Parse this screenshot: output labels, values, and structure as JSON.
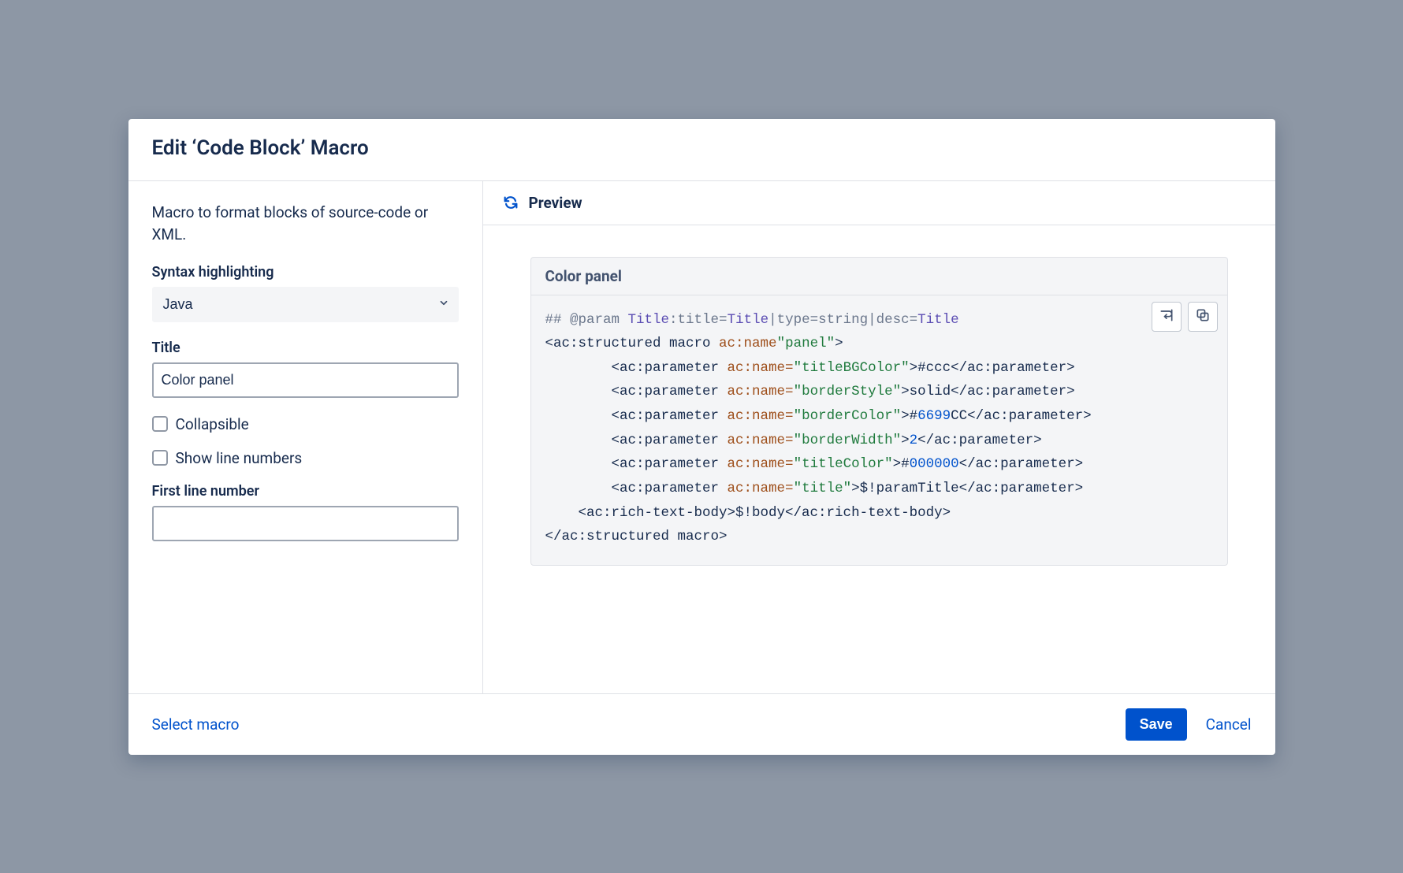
{
  "dialog": {
    "title": "Edit ‘Code Block’ Macro"
  },
  "form": {
    "description": "Macro to format blocks of source-code or XML.",
    "syntax_label": "Syntax highlighting",
    "syntax_value": "Java",
    "title_label": "Title",
    "title_value": "Color panel",
    "collapsible_label": "Collapsible",
    "collapsible_checked": false,
    "line_numbers_label": "Show line numbers",
    "line_numbers_checked": false,
    "first_line_label": "First line number",
    "first_line_value": ""
  },
  "preview": {
    "header": "Preview",
    "block_title": "Color panel",
    "code_tokens": [
      {
        "t": "comment",
        "v": "## @param "
      },
      {
        "t": "kw",
        "v": "Title"
      },
      {
        "t": "comment",
        "v": ":title="
      },
      {
        "t": "kw",
        "v": "Title"
      },
      {
        "t": "comment",
        "v": "|type=string|desc="
      },
      {
        "t": "kw",
        "v": "Title"
      },
      {
        "t": "nl"
      },
      {
        "t": "tag",
        "v": "<ac:structured macro "
      },
      {
        "t": "attr",
        "v": "ac:name"
      },
      {
        "t": "str",
        "v": "\"panel\""
      },
      {
        "t": "tag",
        "v": ">"
      },
      {
        "t": "nl"
      },
      {
        "t": "tag",
        "v": "        <ac:parameter "
      },
      {
        "t": "attr",
        "v": "ac:name="
      },
      {
        "t": "str",
        "v": "\"titleBGColor\""
      },
      {
        "t": "tag",
        "v": ">#ccc</ac:parameter>"
      },
      {
        "t": "nl"
      },
      {
        "t": "tag",
        "v": "        <ac:parameter "
      },
      {
        "t": "attr",
        "v": "ac:name="
      },
      {
        "t": "str",
        "v": "\"borderStyle\""
      },
      {
        "t": "tag",
        "v": ">solid</ac:parameter>"
      },
      {
        "t": "nl"
      },
      {
        "t": "tag",
        "v": "        <ac:parameter "
      },
      {
        "t": "attr",
        "v": "ac:name="
      },
      {
        "t": "str",
        "v": "\"borderColor\""
      },
      {
        "t": "tag",
        "v": ">#"
      },
      {
        "t": "val",
        "v": "6699"
      },
      {
        "t": "tag",
        "v": "CC</ac:parameter>"
      },
      {
        "t": "nl"
      },
      {
        "t": "tag",
        "v": "        <ac:parameter "
      },
      {
        "t": "attr",
        "v": "ac:name="
      },
      {
        "t": "str",
        "v": "\"borderWidth\""
      },
      {
        "t": "tag",
        "v": ">"
      },
      {
        "t": "val",
        "v": "2"
      },
      {
        "t": "tag",
        "v": "</ac:parameter>"
      },
      {
        "t": "nl"
      },
      {
        "t": "tag",
        "v": "        <ac:parameter "
      },
      {
        "t": "attr",
        "v": "ac:name="
      },
      {
        "t": "str",
        "v": "\"titleColor\""
      },
      {
        "t": "tag",
        "v": ">#"
      },
      {
        "t": "val",
        "v": "000000"
      },
      {
        "t": "tag",
        "v": "</ac:parameter>"
      },
      {
        "t": "nl"
      },
      {
        "t": "tag",
        "v": "        <ac:parameter "
      },
      {
        "t": "attr",
        "v": "ac:name="
      },
      {
        "t": "str",
        "v": "\"title\""
      },
      {
        "t": "tag",
        "v": ">$!paramTitle</ac:parameter>"
      },
      {
        "t": "nl"
      },
      {
        "t": "tag",
        "v": "    <ac:rich-text-body>$!body</ac:rich-text-body>"
      },
      {
        "t": "nl"
      },
      {
        "t": "tag",
        "v": "</ac:structured macro>"
      }
    ]
  },
  "footer": {
    "select_macro": "Select macro",
    "save": "Save",
    "cancel": "Cancel"
  },
  "colors": {
    "primary": "#0052cc",
    "text": "#172B4D"
  }
}
